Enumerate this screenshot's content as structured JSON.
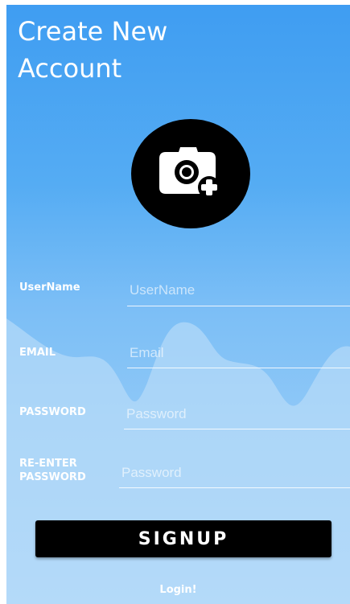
{
  "header": {
    "title_line1": "Create New",
    "title_line2": "Account"
  },
  "avatar": {
    "icon": "camera-add-icon"
  },
  "form": {
    "username": {
      "label": "UserName",
      "placeholder": "UserName",
      "value": ""
    },
    "email": {
      "label": "EMAIL",
      "placeholder": "Email",
      "value": ""
    },
    "password": {
      "label": "PASSWORD",
      "placeholder": "Password",
      "value": ""
    },
    "reenter_password": {
      "label_line1": "RE-ENTER",
      "label_line2": "PASSWORD",
      "placeholder": "Password",
      "value": ""
    }
  },
  "actions": {
    "signup_label": "SIGNUP",
    "login_label": "Login!"
  },
  "colors": {
    "background_top": "#3f9df2",
    "background_bottom": "#9fd0f8",
    "wave": "#c4e2f9",
    "button": "#000000",
    "text": "#ffffff"
  }
}
